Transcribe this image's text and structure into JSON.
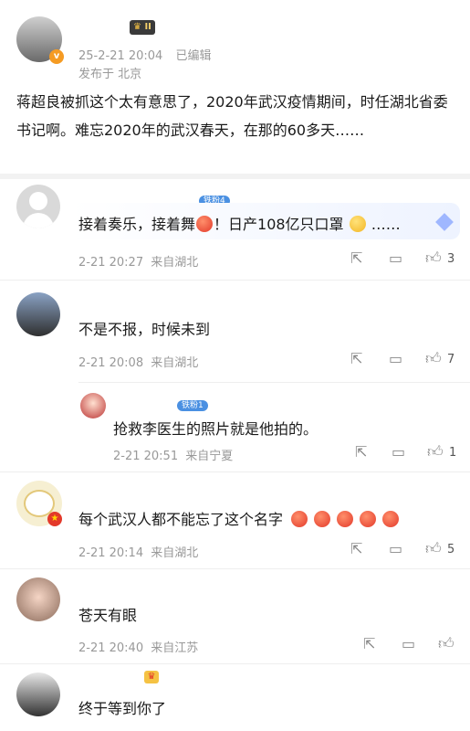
{
  "post": {
    "time": "25-2-21 20:04",
    "edited": "已编辑",
    "location": "发布于 北京",
    "level_badge": "II",
    "body": "蒋超良被抓这个太有意思了，2020年武汉疫情期间，时任湖北省委书记啊。难忘2020年的武汉春天，在那的60多天……"
  },
  "comments": [
    {
      "badge": "铁粉4",
      "text_pre": "接着奏乐，接着舞",
      "text_mid": "！日产108亿只口罩",
      "text_post": "……",
      "time": "2-21 20:27",
      "source": "来自湖北",
      "likes": "3"
    },
    {
      "text": "不是不报，时候未到",
      "time": "2-21 20:08",
      "source": "来自湖北",
      "likes": "7"
    },
    {
      "badge": "铁粉1",
      "text": "抢救李医生的照片就是他拍的。",
      "time": "2-21 20:51",
      "source": "来自宁夏",
      "likes": "1"
    },
    {
      "text": "每个武汉人都不能忘了这个名字",
      "time": "2-21 20:14",
      "source": "来自湖北",
      "likes": "5"
    },
    {
      "text": "苍天有眼",
      "time": "2-21 20:40",
      "source": "来自江苏",
      "likes": ""
    },
    {
      "text": "终于等到你了"
    }
  ],
  "icons": {
    "share": "share-icon",
    "comment": "comment-icon",
    "like": "thumbs-up-icon"
  },
  "colors": {
    "badge_blue": "#4a90e2",
    "vip_orange": "#f59b23",
    "meta_gray": "#999999"
  }
}
